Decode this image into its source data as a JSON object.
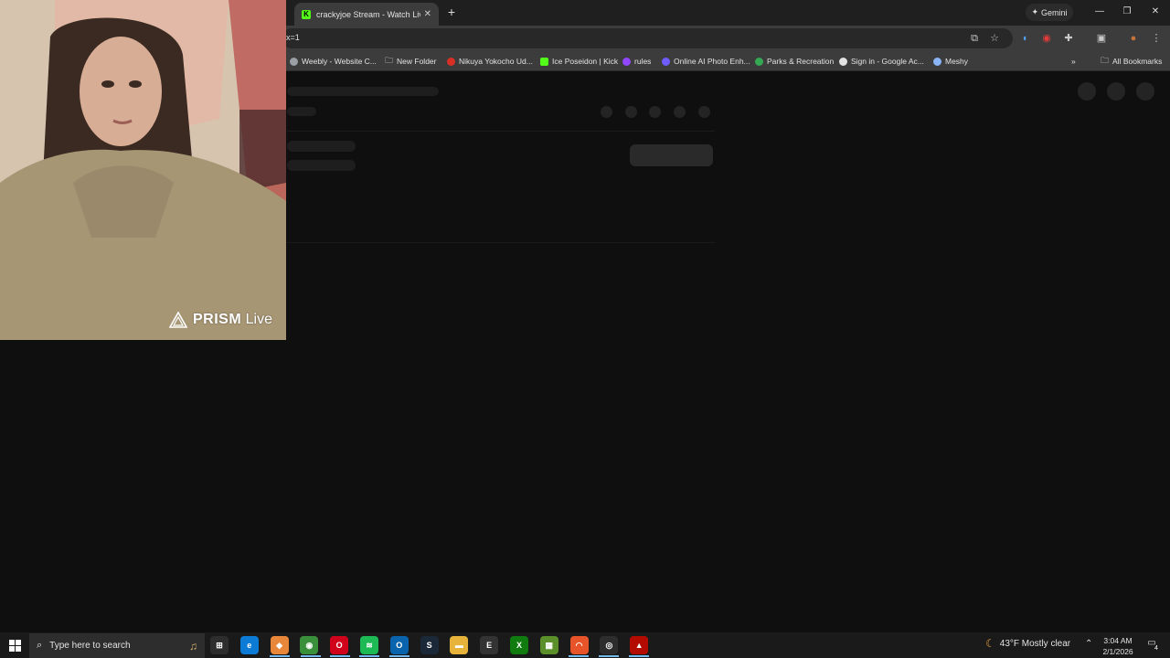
{
  "browser": {
    "tab_title": "crackyjoe Stream - Watch Live",
    "tab_close": "✕",
    "new_tab": "+",
    "gemini_label": "Gemini",
    "window_min": "—",
    "window_restore": "❐",
    "window_close": "✕",
    "url": "x=1"
  },
  "bookmarks": [
    {
      "label": "Weebly - Website C...",
      "icon": "globe-icon",
      "color": "#9aa0a6"
    },
    {
      "label": "New Folder",
      "icon": "folder-icon",
      "color": "#c8c8c8"
    },
    {
      "label": "Nikuya Yokocho Ud...",
      "icon": "restaurant-icon",
      "color": "#d93025"
    },
    {
      "label": "Ice Poseidon | Kick",
      "icon": "kick-icon",
      "color": "#53fc18"
    },
    {
      "label": "rules",
      "icon": "twitch-icon",
      "color": "#9146ff"
    },
    {
      "label": "Online AI Photo Enh...",
      "icon": "photo-ai-icon",
      "color": "#6f5cff"
    },
    {
      "label": "Parks & Recreation",
      "icon": "parks-icon",
      "color": "#34a853"
    },
    {
      "label": "Sign in - Google Ac...",
      "icon": "google-icon",
      "color": "#e3e3e3"
    },
    {
      "label": "Meshy",
      "icon": "meshy-icon",
      "color": "#8ab4f8"
    }
  ],
  "all_bookmarks": "All Bookmarks",
  "overlay": {
    "brand": "PRISM",
    "brand_suffix": "Live"
  },
  "taskbar": {
    "search_placeholder": "Type here to search",
    "weather": "43°F  Mostly clear",
    "time": "3:04 AM",
    "date": "2/1/2026",
    "notification_count": "4",
    "apps": [
      {
        "name": "task-view-icon",
        "color": "#2d2d2d",
        "glyph": "⊞"
      },
      {
        "name": "edge-icon",
        "color": "#0c7bd6",
        "glyph": "e"
      },
      {
        "name": "copilot-icon",
        "color": "#e8863a",
        "glyph": "◆"
      },
      {
        "name": "chrome-icon",
        "color": "#3a8f3a",
        "glyph": "◉"
      },
      {
        "name": "opera-icon",
        "color": "#d0021b",
        "glyph": "O"
      },
      {
        "name": "spotify-icon",
        "color": "#1db954",
        "glyph": "≋"
      },
      {
        "name": "outlook-icon",
        "color": "#0a64ad",
        "glyph": "O"
      },
      {
        "name": "steam-icon",
        "color": "#1b2838",
        "glyph": "S"
      },
      {
        "name": "file-explorer-icon",
        "color": "#e8b33a",
        "glyph": "▬"
      },
      {
        "name": "epic-games-icon",
        "color": "#333333",
        "glyph": "E"
      },
      {
        "name": "xbox-icon",
        "color": "#107c10",
        "glyph": "X"
      },
      {
        "name": "minecraft-icon",
        "color": "#5a8f2a",
        "glyph": "▦"
      },
      {
        "name": "brave-icon",
        "color": "#e8542a",
        "glyph": "◠"
      },
      {
        "name": "obs-icon",
        "color": "#2d2d2d",
        "glyph": "◎"
      },
      {
        "name": "acrobat-icon",
        "color": "#b30b00",
        "glyph": "▲"
      }
    ]
  }
}
